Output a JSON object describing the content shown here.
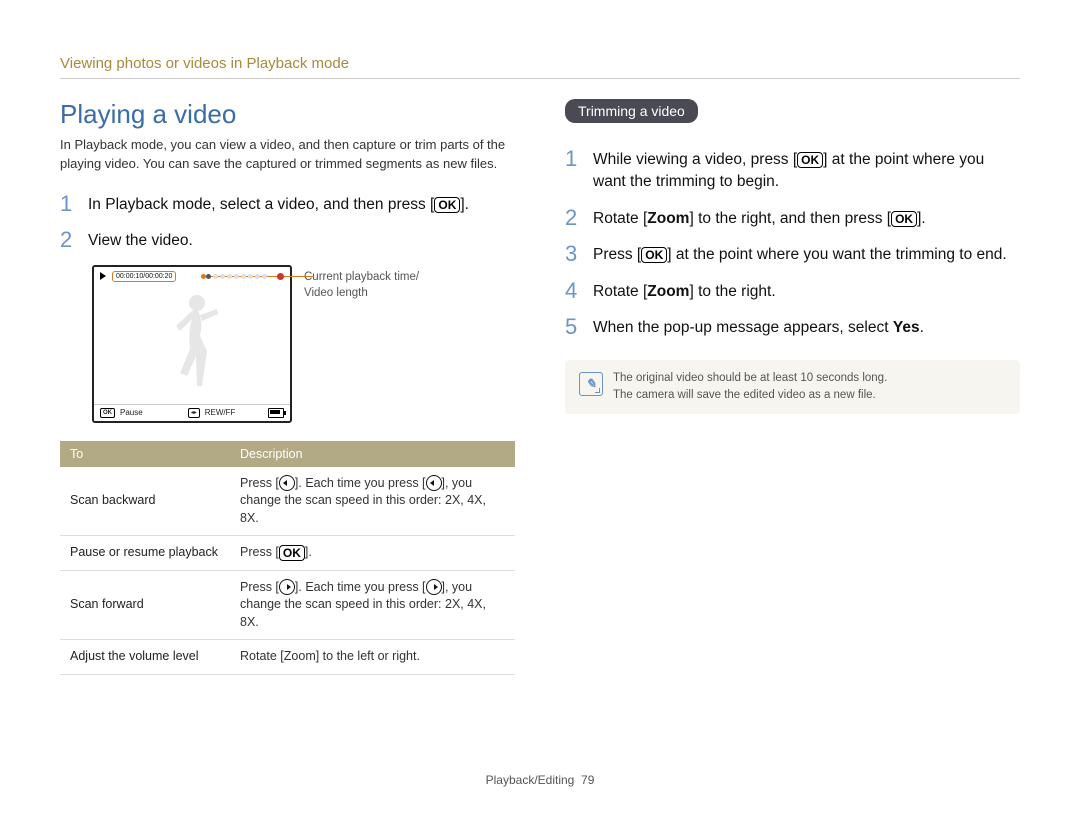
{
  "breadcrumb": "Viewing photos or videos in Playback mode",
  "heading": "Playing a video",
  "intro": "In Playback mode, you can view a video, and then capture or trim parts of the playing video. You can save the captured or trimmed segments as new files.",
  "leftSteps": {
    "s1_pre": "In Playback mode, select a video, and then press [",
    "s1_post": "].",
    "s2": "View the video."
  },
  "video": {
    "time": "00:00:10/00:00:20",
    "pauseLabel": "Pause",
    "rewffLabel": "REW/FF"
  },
  "callout": {
    "line1": "Current playback time/",
    "line2": "Video length"
  },
  "table": {
    "head": {
      "to": "To",
      "desc": "Description"
    },
    "rows": {
      "r1": {
        "to": "Scan backward",
        "pre": "Press [",
        "mid": "]. Each time you press [",
        "post": "], you change the scan speed in this order: 2X, 4X, 8X."
      },
      "r2": {
        "to": "Pause or resume playback",
        "pre": "Press [",
        "post": "]."
      },
      "r3": {
        "to": "Scan forward",
        "pre": "Press [",
        "mid": "]. Each time you press [",
        "post": "], you change the scan speed in this order: 2X, 4X, 8X."
      },
      "r4": {
        "to": "Adjust the volume level",
        "desc_pre": "Rotate [",
        "desc_bold": "Zoom",
        "desc_post": "] to the left or right."
      }
    }
  },
  "subHeading": "Trimming a video",
  "rightSteps": {
    "s1_pre": "While viewing a video, press [",
    "s1_post": "] at the point where you want the trimming to begin.",
    "s2_pre": "Rotate [",
    "s2_bold": "Zoom",
    "s2_mid": "] to the right, and then press [",
    "s2_post": "].",
    "s3_pre": "Press [",
    "s3_post": "] at the point where you want the trimming to end.",
    "s4_pre": "Rotate [",
    "s4_bold": "Zoom",
    "s4_post": "] to the right.",
    "s5_pre": "When the pop-up message appears, select ",
    "s5_bold": "Yes",
    "s5_post": "."
  },
  "note": {
    "line1": "The original video should be at least 10 seconds long.",
    "line2": "The camera will save the edited video as a new file."
  },
  "footer": {
    "section": "Playback/Editing",
    "page": "79"
  },
  "nums": {
    "n1": "1",
    "n2": "2",
    "n3": "3",
    "n4": "4",
    "n5": "5"
  },
  "ok": "OK"
}
